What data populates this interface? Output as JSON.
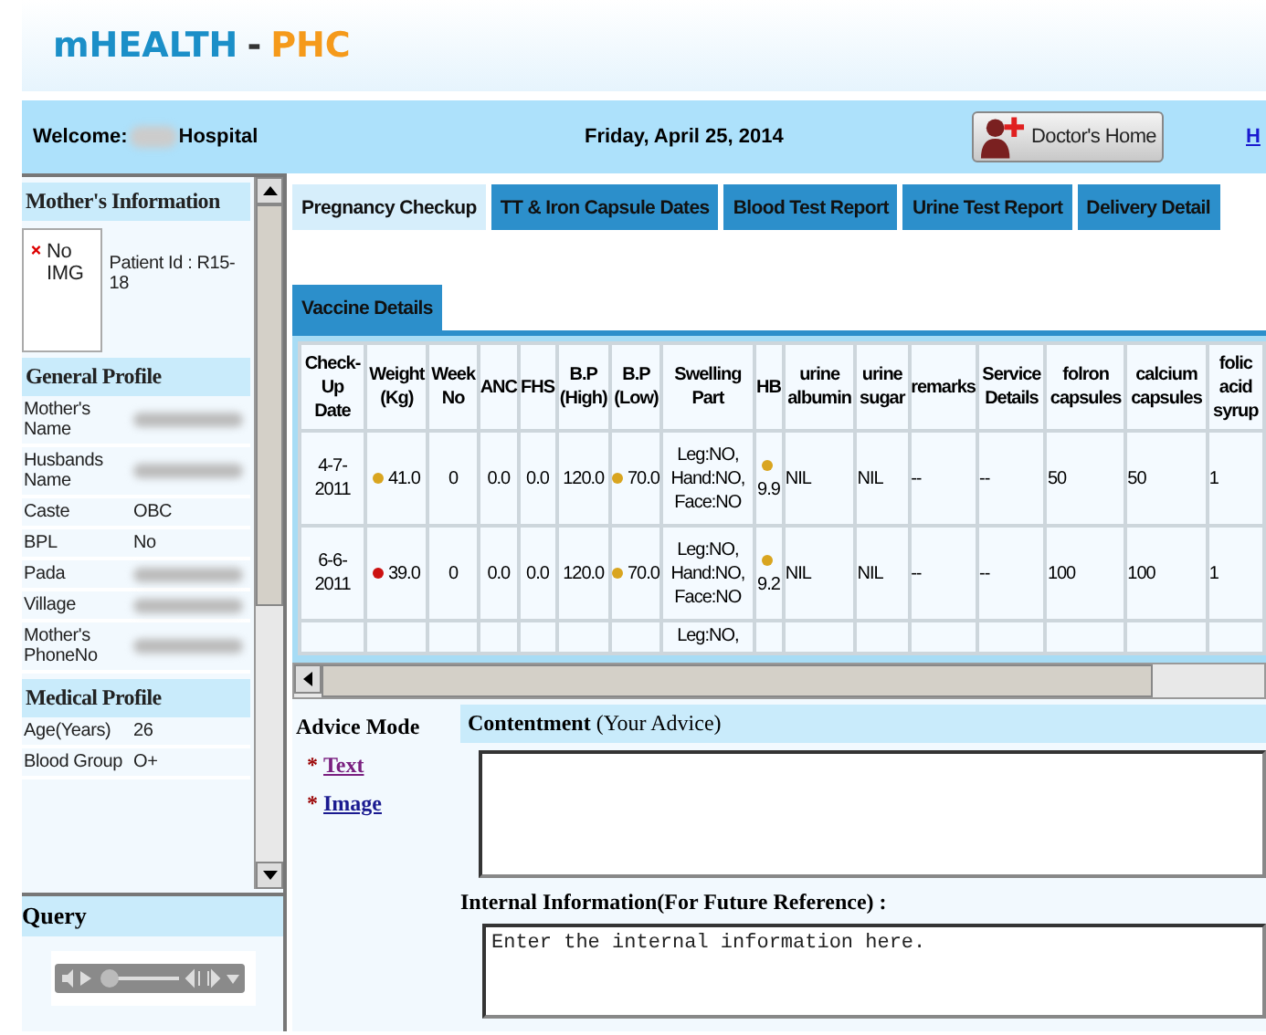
{
  "header": {
    "brand": "mHEALTH",
    "separator": "-",
    "product": "PHC"
  },
  "welcome_bar": {
    "welcome": "Welcome:",
    "hospital": "Hospital",
    "date": "Friday, April 25, 2014",
    "doctor_button": "Doctor's Home",
    "link": "H"
  },
  "sidebar": {
    "mother_info": {
      "title": "Mother's Information",
      "photo_alt": "No IMG",
      "patient_id": "Patient Id :  R15-18"
    },
    "sections": [
      {
        "title": "General Profile",
        "rows": [
          {
            "label": "Mother's Name",
            "redacted": true
          },
          {
            "label": "Husbands Name",
            "redacted": true
          },
          {
            "label": "Caste",
            "value": "OBC",
            "redacted": false
          },
          {
            "label": "BPL",
            "value": "No",
            "redacted": false
          },
          {
            "label": "Pada",
            "redacted": true
          },
          {
            "label": "Village",
            "redacted": true
          },
          {
            "label": "Mother's PhoneNo",
            "redacted": true
          }
        ]
      },
      {
        "title": "Medical Profile",
        "rows": [
          {
            "label": "Age(Years)",
            "value": "26",
            "redacted": false
          },
          {
            "label": "Blood Group",
            "value": "O+",
            "redacted": false
          }
        ]
      }
    ],
    "query_title": "Query"
  },
  "tab_rows": [
    [
      {
        "label": "Pregnancy Checkup",
        "selected": true
      },
      {
        "label": "TT & Iron Capsule Dates",
        "selected": false
      },
      {
        "label": "Blood Test Report",
        "selected": false
      },
      {
        "label": "Urine Test Report",
        "selected": false
      },
      {
        "label": "Delivery Detail",
        "selected": false
      }
    ],
    [
      {
        "label": "Vaccine Details",
        "selected": false
      }
    ]
  ],
  "table": {
    "columns": [
      "Check-Up Date",
      "Weight (Kg)",
      "Week No",
      "ANC",
      "FHS",
      "B.P (High)",
      "B.P (Low)",
      "Swelling Part",
      "HB",
      "urine albumin",
      "urine sugar",
      "remarks",
      "Service Details",
      "folron capsules",
      "calcium capsules",
      "folic acid syrup"
    ],
    "rows": [
      {
        "cells": [
          {
            "text": "4-7-2011"
          },
          {
            "text": "41.0",
            "color": "#d9a520"
          },
          {
            "text": "0"
          },
          {
            "text": "0.0"
          },
          {
            "text": "0.0"
          },
          {
            "text": "120.0"
          },
          {
            "text": "70.0",
            "color": "#d9a520"
          },
          {
            "text": "Leg:NO, Hand:NO, Face:NO"
          },
          {
            "text": "9.9",
            "color": "#d9a520"
          },
          {
            "text": "NIL"
          },
          {
            "text": "NIL"
          },
          {
            "text": "--"
          },
          {
            "text": "--"
          },
          {
            "text": "50"
          },
          {
            "text": "50"
          },
          {
            "text": "1"
          }
        ]
      },
      {
        "cells": [
          {
            "text": "6-6-2011"
          },
          {
            "text": "39.0",
            "color": "#cc1111"
          },
          {
            "text": "0"
          },
          {
            "text": "0.0"
          },
          {
            "text": "0.0"
          },
          {
            "text": "120.0"
          },
          {
            "text": "70.0",
            "color": "#d9a520"
          },
          {
            "text": "Leg:NO, Hand:NO, Face:NO"
          },
          {
            "text": "9.2",
            "color": "#d9a520"
          },
          {
            "text": "NIL"
          },
          {
            "text": "NIL"
          },
          {
            "text": "--"
          },
          {
            "text": "--"
          },
          {
            "text": "100"
          },
          {
            "text": "100"
          },
          {
            "text": "1"
          }
        ]
      },
      {
        "cells": [
          {},
          {},
          {},
          {},
          {},
          {},
          {},
          {
            "text": "Leg:NO,"
          },
          {},
          {},
          {},
          {},
          {},
          {},
          {},
          {}
        ]
      }
    ]
  },
  "advice": {
    "title": "Advice Mode",
    "options": [
      {
        "bullet": "*",
        "label": "Text",
        "visited": true
      },
      {
        "bullet": "*",
        "label": "Image",
        "visited": false
      }
    ]
  },
  "contentment": {
    "label": "**Contentment** (Your Advice)"
  },
  "internal": {
    "label": "Internal Information(For Future Reference) :",
    "value": "Enter the internal information here."
  }
}
